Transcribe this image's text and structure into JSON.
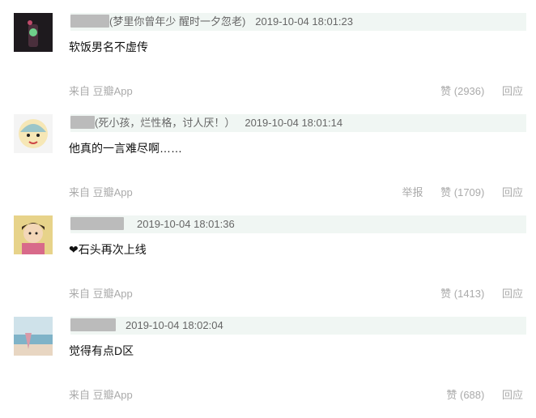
{
  "comments": [
    {
      "nick_suffix": "(梦里你曾年少 醒时一夕忽老)",
      "time": "2019-10-04 18:01:23",
      "text": "软饭男名不虚传",
      "source": "来自 豆瓣App",
      "report_label": "",
      "like_label": "赞 (2936)",
      "reply_label": "回应"
    },
    {
      "nick_suffix": "(死小孩，烂性格，讨人厌！）",
      "time": "2019-10-04 18:01:14",
      "text": "他真的一言难尽啊……",
      "source": "来自 豆瓣App",
      "report_label": "举报",
      "like_label": "赞 (1709)",
      "reply_label": "回应"
    },
    {
      "nick_suffix": "",
      "time": "2019-10-04 18:01:36",
      "text": "❤石头再次上线",
      "source": "来自 豆瓣App",
      "report_label": "",
      "like_label": "赞 (1413)",
      "reply_label": "回应"
    },
    {
      "nick_suffix": "",
      "time": "2019-10-04 18:02:04",
      "text": "觉得有点D区",
      "source": "来自 豆瓣App",
      "report_label": "",
      "like_label": "赞 (688)",
      "reply_label": "回应"
    }
  ]
}
